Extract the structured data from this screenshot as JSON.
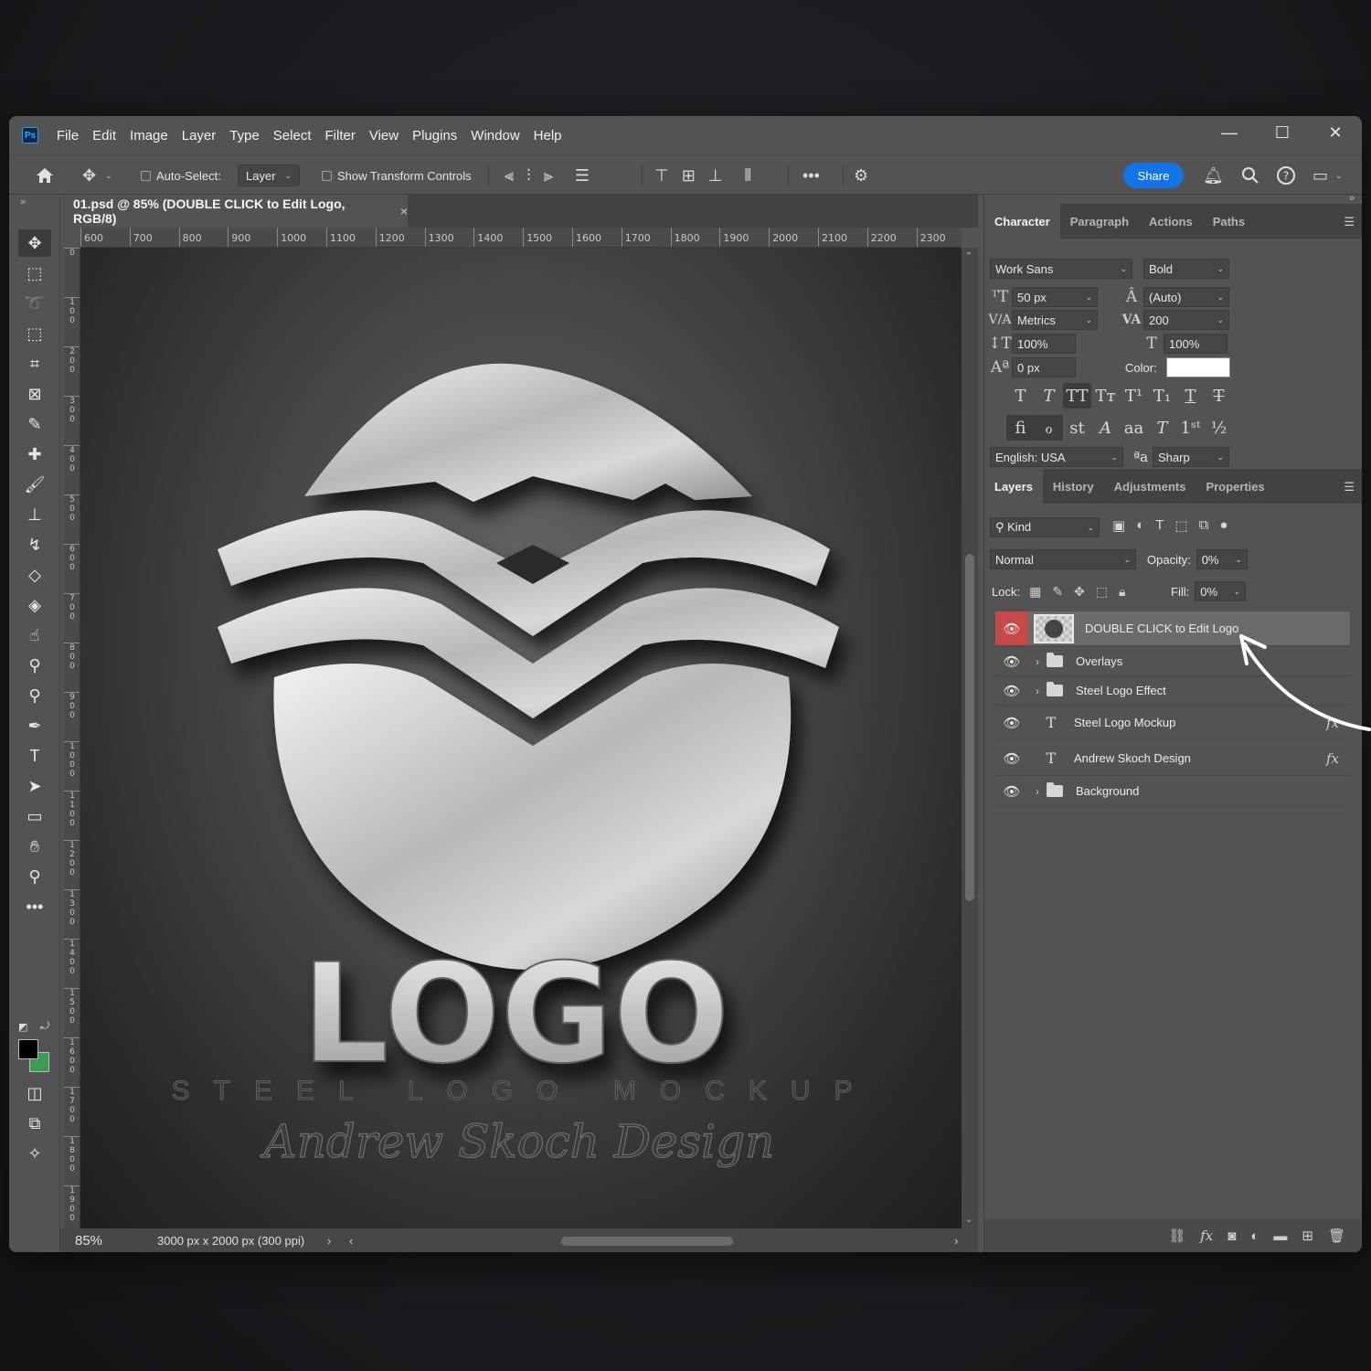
{
  "menubar": {
    "app_icon": "Ps",
    "items": [
      "File",
      "Edit",
      "Image",
      "Layer",
      "Type",
      "Select",
      "Filter",
      "View",
      "Plugins",
      "Window",
      "Help"
    ]
  },
  "window_controls": {
    "minimize": "—",
    "maximize": "☐",
    "close": "✕"
  },
  "options_bar": {
    "auto_select_label": "Auto-Select:",
    "auto_select_target": "Layer",
    "show_transform_label": "Show Transform Controls",
    "share_label": "Share"
  },
  "document": {
    "tab_title": "01.psd @ 85% (DOUBLE CLICK to Edit Logo, RGB/8)",
    "tab_close": "×",
    "zoom": "85%",
    "doc_info": "3000 px x 2000 px (300 ppi)",
    "ruler_h": [
      "600",
      "700",
      "800",
      "900",
      "1000",
      "1100",
      "1200",
      "1300",
      "1400",
      "1500",
      "1600",
      "1700",
      "1800",
      "1900",
      "2000",
      "2100",
      "2200",
      "2300"
    ],
    "ruler_v": [
      "0",
      "100",
      "200",
      "300",
      "400",
      "500",
      "600",
      "700",
      "800",
      "900",
      "1000",
      "1100",
      "1200",
      "1300",
      "1400",
      "1500",
      "1600",
      "1700",
      "1800",
      "1900"
    ]
  },
  "artwork": {
    "headline": "LOGO",
    "tagline": "STEEL LOGO MOCKUP",
    "signature": "Andrew Skoch Design"
  },
  "character_panel": {
    "tabs": [
      "Character",
      "Paragraph",
      "Actions",
      "Paths"
    ],
    "font_family": "Work Sans",
    "font_style": "Bold",
    "font_size": "50 px",
    "leading": "(Auto)",
    "kerning": "Metrics",
    "tracking": "200",
    "vertical_scale": "100%",
    "horizontal_scale": "100%",
    "baseline_shift": "0 px",
    "color_label": "Color:",
    "color_value": "#ffffff",
    "language": "English: USA",
    "aa_icon": "ªa",
    "antialias": "Sharp"
  },
  "layers_panel": {
    "tabs": [
      "Layers",
      "History",
      "Adjustments",
      "Properties"
    ],
    "filter_label": "Kind",
    "blend_mode": "Normal",
    "opacity_label": "Opacity:",
    "opacity_value": "0%",
    "lock_label": "Lock:",
    "fill_label": "Fill:",
    "fill_value": "0%",
    "layers": [
      {
        "name": "DOUBLE CLICK to Edit Logo",
        "kind": "smart",
        "selected": true
      },
      {
        "name": "Overlays",
        "kind": "group"
      },
      {
        "name": "Steel Logo Effect",
        "kind": "group"
      },
      {
        "name": "Steel Logo Mockup",
        "kind": "text",
        "fx": "fx"
      },
      {
        "name": "Andrew Skoch Design",
        "kind": "text",
        "fx": "fx"
      },
      {
        "name": "Background",
        "kind": "group"
      }
    ]
  },
  "colors": {
    "accent_blue": "#1473e6",
    "selected_eye_red": "#c64a4a",
    "background_swatch": "#3c9a54"
  }
}
